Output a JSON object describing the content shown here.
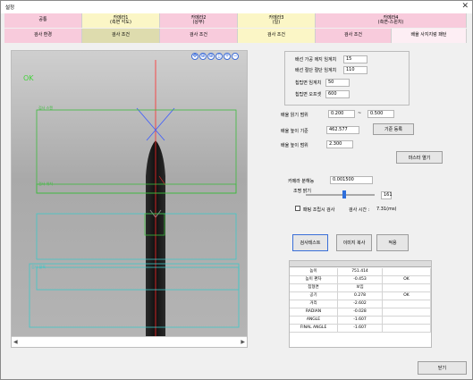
{
  "window": {
    "title": "설정",
    "close_glyph": "✕"
  },
  "tabs": [
    {
      "label": "공통",
      "bg": "#f8cbdc"
    },
    {
      "label": "카메라1\n(측면 각도)",
      "bg": "#fbf6c6"
    },
    {
      "label": "카메라2\n(상부)",
      "bg": "#f8cbdc"
    },
    {
      "label": "카메라3\n(일)",
      "bg": "#fbf6c6"
    },
    {
      "label": "카메라4\n(측면-스윈치)",
      "bg": "#f8cbdc"
    }
  ],
  "subtabs": [
    {
      "label": "검사 환경",
      "bg": "#f8cbdc"
    },
    {
      "label": "검사 조건",
      "bg": "#dedcae"
    },
    {
      "label": "검사 조건",
      "bg": "#f8cbdc"
    },
    {
      "label": "검사 조건",
      "bg": "#fbf6c6"
    },
    {
      "label": "검사 조건",
      "bg": "#f8cbdc"
    },
    {
      "label": "배율 사지지렁 패턴",
      "bg": "#fdeef4"
    }
  ],
  "image_panel": {
    "ok_text": "OK",
    "roi_labels": [
      "검사 스캔",
      "검사 위치",
      "검사 블록"
    ],
    "icons": [
      "zoom-in-icon",
      "fit-icon",
      "zoom-icon",
      "window-icon",
      "plus-icon",
      "minus-icon"
    ],
    "icon_glyphs": [
      "✥",
      "⊕",
      "⊕",
      "▯",
      "+",
      "−"
    ],
    "scroll_left": "◀",
    "scroll_right": "▶"
  },
  "thresholds": {
    "edge_label": "배선 가공 에지 임계치",
    "edge_value": "15",
    "cut_label": "배선 절단 절단 임계치",
    "cut_value": "110",
    "tip_label": "칩팁면 임계치",
    "tip_value": "50",
    "offset_label": "칩팁면 오프셋",
    "offset_value": "600"
  },
  "params": {
    "range_label": "배율 읽기 범위",
    "range_from": "0.200",
    "range_sep": "~",
    "range_to": "0.500",
    "height_label": "배율 높이 기준",
    "height_value": "462.577",
    "height_button": "기준 등록",
    "tol_label": "배율 높이 범위",
    "tol_value": "2.300",
    "master_button": "마스터 열기"
  },
  "camera": {
    "resolution_label": "카메라 분해능",
    "resolution_value": "0.001500",
    "light_label": "조명 밝기",
    "light_value": "161",
    "light_level_percent": 56,
    "save_image_label": "패팅 조립시 검사",
    "inspect_time_label": "검사 시간 : ",
    "inspect_time_value": "7.31(ms)"
  },
  "actions": {
    "test": "검사테스트",
    "copy": "이미지 복사",
    "apply": "적용"
  },
  "results": {
    "rows": [
      {
        "name": "높이",
        "value": "751.414",
        "status": ""
      },
      {
        "name": "높이 편차",
        "value": "-0.453",
        "status": "OK"
      },
      {
        "name": "칩형면",
        "value": "보임",
        "status": ""
      },
      {
        "name": "공기",
        "value": "0.278",
        "status": "OK"
      },
      {
        "name": "거리",
        "value": "-2.602",
        "status": ""
      },
      {
        "name": "RADIAN",
        "value": "-0.028",
        "status": ""
      },
      {
        "name": "ANGLE",
        "value": "-1.607",
        "status": ""
      },
      {
        "name": "FINAL ANGLE",
        "value": "-1.607",
        "status": ""
      }
    ]
  },
  "footer": {
    "close_button": "닫기"
  },
  "colors": {
    "roi_green": "#3dbb3d",
    "roi_cyan": "#3fc7c7",
    "guide_red": "#ff2a2a",
    "guide_blue": "#3b5bff",
    "slider_blue": "#2f6fdb"
  }
}
